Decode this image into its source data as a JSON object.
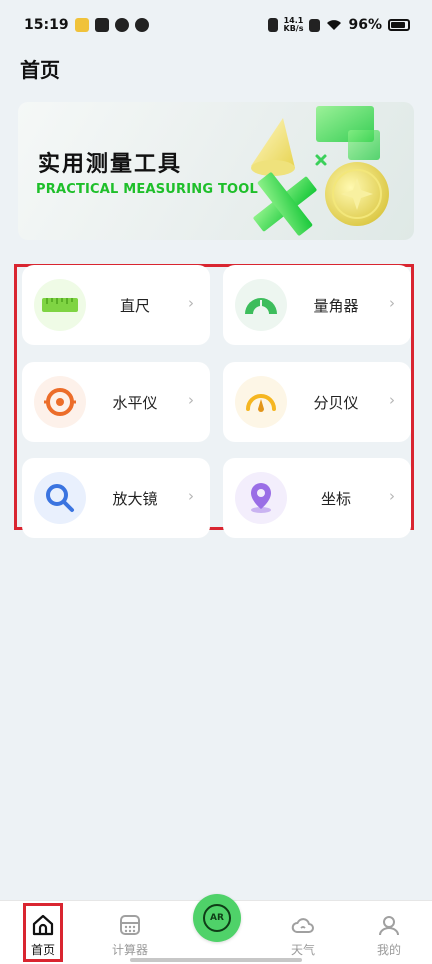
{
  "status_bar": {
    "time": "15:19",
    "net_speed_value": "14.1",
    "net_speed_unit": "KB/s",
    "battery": "96%"
  },
  "page": {
    "title": "首页"
  },
  "banner": {
    "title": "实用测量工具",
    "subtitle": "PRACTICAL MEASURING TOOL"
  },
  "tools": [
    {
      "label": "直尺",
      "icon": "ruler-icon",
      "arrow": "›"
    },
    {
      "label": "量角器",
      "icon": "protractor-icon",
      "arrow": "›"
    },
    {
      "label": "水平仪",
      "icon": "level-icon",
      "arrow": "›"
    },
    {
      "label": "分贝仪",
      "icon": "decibel-meter-icon",
      "arrow": "›"
    },
    {
      "label": "放大镜",
      "icon": "magnifier-icon",
      "arrow": "›"
    },
    {
      "label": "坐标",
      "icon": "location-pin-icon",
      "arrow": "›"
    }
  ],
  "bottom_nav": {
    "items": [
      {
        "label": "首页",
        "icon": "home-icon",
        "active": true
      },
      {
        "label": "计算器",
        "icon": "calculator-icon",
        "active": false
      },
      {
        "label": "AR",
        "icon": "ar-icon",
        "active": false
      },
      {
        "label": "天气",
        "icon": "cloud-icon",
        "active": false
      },
      {
        "label": "我的",
        "icon": "user-icon",
        "active": false
      }
    ]
  },
  "colors": {
    "accent_green": "#4fd269",
    "banner_subtitle": "#1ebf2a",
    "highlight_red": "#d92530",
    "background": "#edf2f5"
  }
}
